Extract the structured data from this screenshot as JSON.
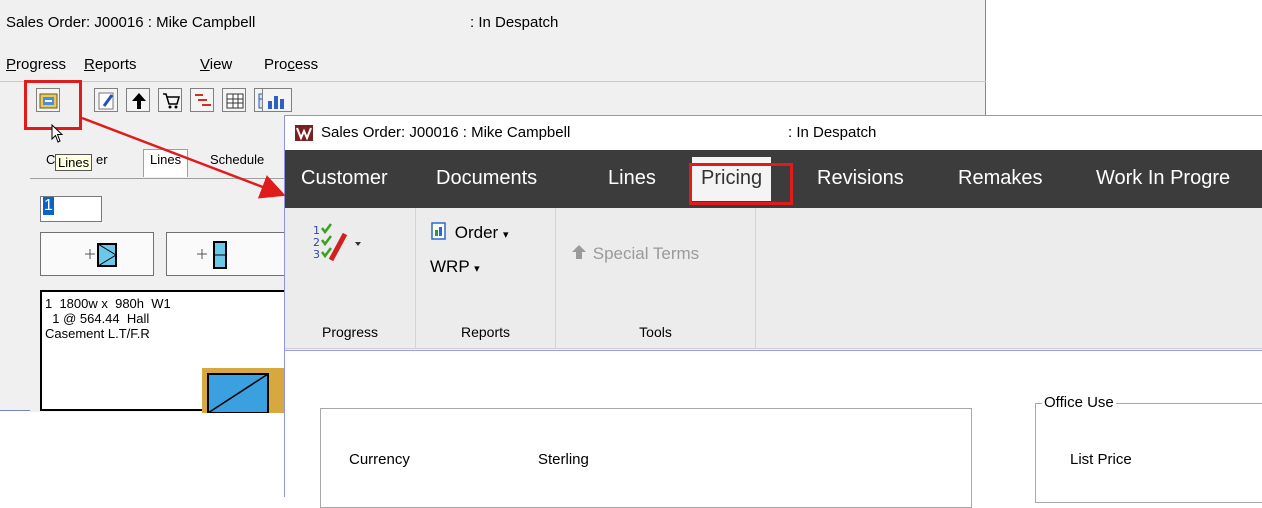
{
  "old_window": {
    "title": "Sales Order: J00016 : Mike Campbell",
    "status": ": In Despatch",
    "menu": [
      {
        "label_pre": "",
        "label_u": "P",
        "label_post": "rogress"
      },
      {
        "label_pre": "",
        "label_u": "R",
        "label_post": "eports"
      },
      {
        "label_pre": "",
        "label_u": "V",
        "label_post": "iew"
      },
      {
        "label_pre": "Pro",
        "label_u": "c",
        "label_post": "ess"
      }
    ],
    "tooltip": "Lines",
    "tabs": [
      "C",
      "er",
      "Lines",
      "Schedule"
    ],
    "input_value": "1",
    "list_lines": [
      "1  1800w x  980h  W1",
      "  1 @ 564.44  Hall",
      "Casement L.T/F.R"
    ]
  },
  "new_window": {
    "title": "Sales Order: J00016 : Mike Campbell",
    "status": ": In Despatch",
    "tabs": [
      "Customer",
      "Documents",
      "Lines",
      "Pricing",
      "Revisions",
      "Remakes",
      "Work In Progre"
    ],
    "active_tab": "Pricing",
    "ribbon": {
      "progress_label": "Progress",
      "order_button": "Order",
      "wrp_button": "WRP",
      "reports_label": "Reports",
      "special_terms": "Special Terms",
      "tools_label": "Tools"
    },
    "content": {
      "currency_label": "Currency",
      "currency_value": "Sterling",
      "office_use_legend": "Office Use",
      "list_price_label": "List Price"
    }
  },
  "colors": {
    "highlight": "#e01b1b",
    "ribbon_dark": "#3c3c3c",
    "tooltip_bg": "#ffffe1"
  }
}
